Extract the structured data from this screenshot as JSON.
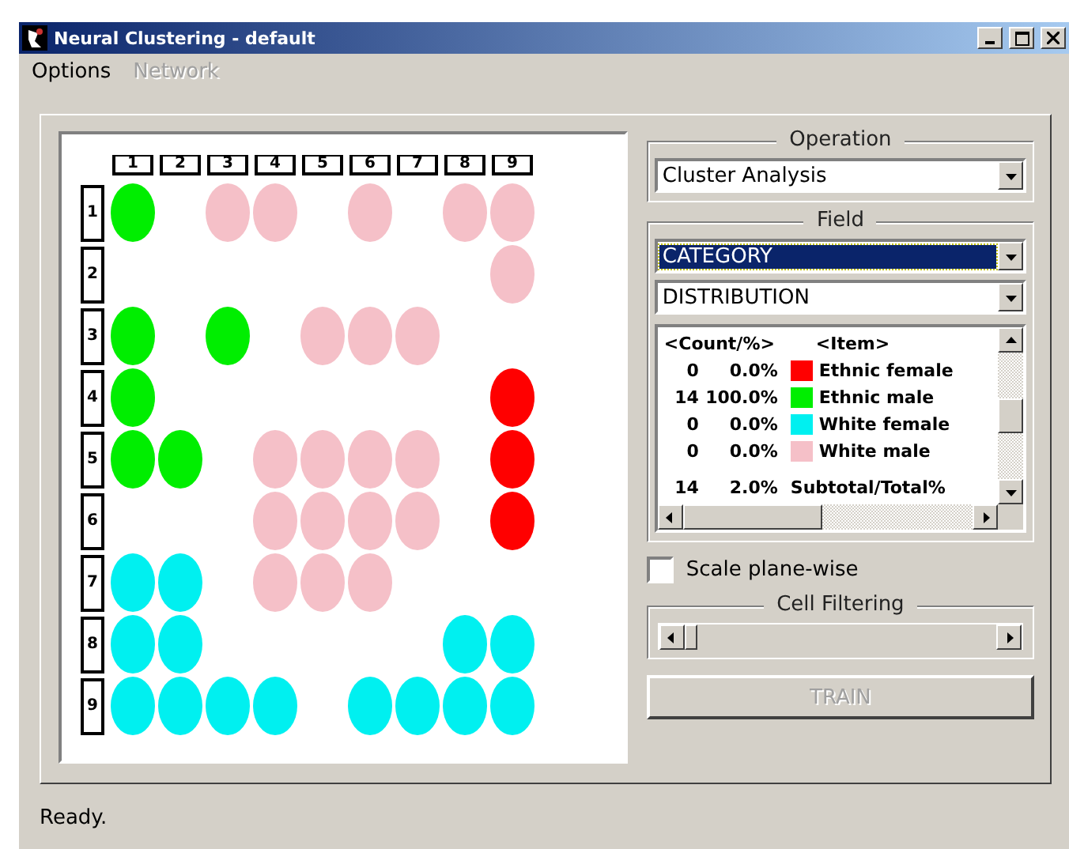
{
  "window": {
    "title": "Neural Clustering - default"
  },
  "menu": [
    {
      "label": "Options",
      "disabled": false
    },
    {
      "label": "Network",
      "disabled": true
    }
  ],
  "map": {
    "column_headers": [
      "1",
      "2",
      "3",
      "4",
      "5",
      "6",
      "7",
      "8",
      "9"
    ],
    "rows": [
      {
        "label": "1",
        "cells": [
          {
            "color": "#00ee00"
          },
          null,
          {
            "color": "#f5c0c8"
          },
          {
            "color": "#f5c0c8"
          },
          null,
          {
            "color": "#f5c0c8"
          },
          null,
          {
            "color": "#f5c0c8"
          },
          {
            "color": "#f5c0c8"
          }
        ]
      },
      {
        "label": "2",
        "cells": [
          null,
          null,
          null,
          null,
          null,
          null,
          null,
          null,
          {
            "color": "#f5c0c8"
          }
        ]
      },
      {
        "label": "3",
        "cells": [
          {
            "color": "#00ee00"
          },
          null,
          {
            "color": "#00ee00"
          },
          null,
          {
            "color": "#f5c0c8"
          },
          {
            "color": "#f5c0c8"
          },
          {
            "color": "#f5c0c8"
          },
          null,
          null
        ]
      },
      {
        "label": "4",
        "cells": [
          {
            "color": "#00ee00"
          },
          null,
          null,
          null,
          null,
          null,
          null,
          null,
          {
            "color": "#ff0000"
          }
        ]
      },
      {
        "label": "5",
        "cells": [
          {
            "color": "#00ee00"
          },
          {
            "color": "#00ee00"
          },
          null,
          {
            "color": "#f5c0c8"
          },
          {
            "color": "#f5c0c8"
          },
          {
            "color": "#f5c0c8"
          },
          {
            "color": "#f5c0c8"
          },
          null,
          {
            "color": "#ff0000"
          }
        ]
      },
      {
        "label": "6",
        "cells": [
          null,
          null,
          null,
          {
            "color": "#f5c0c8"
          },
          {
            "color": "#f5c0c8"
          },
          {
            "color": "#f5c0c8"
          },
          {
            "color": "#f5c0c8"
          },
          null,
          {
            "color": "#ff0000"
          }
        ]
      },
      {
        "label": "7",
        "cells": [
          {
            "color": "#00f0f0"
          },
          {
            "color": "#00f0f0"
          },
          null,
          {
            "color": "#f5c0c8"
          },
          {
            "color": "#f5c0c8"
          },
          {
            "color": "#f5c0c8"
          },
          null,
          null,
          null
        ]
      },
      {
        "label": "8",
        "cells": [
          {
            "color": "#00f0f0"
          },
          {
            "color": "#00f0f0"
          },
          null,
          null,
          null,
          null,
          null,
          {
            "color": "#00f0f0"
          },
          {
            "color": "#00f0f0"
          }
        ]
      },
      {
        "label": "9",
        "cells": [
          {
            "color": "#00f0f0"
          },
          {
            "color": "#00f0f0"
          },
          {
            "color": "#00f0f0"
          },
          {
            "color": "#00f0f0"
          },
          null,
          {
            "color": "#00f0f0"
          },
          {
            "color": "#00f0f0"
          },
          {
            "color": "#00f0f0"
          },
          {
            "color": "#00f0f0"
          }
        ]
      }
    ]
  },
  "operation": {
    "title": "Operation",
    "value": "Cluster Analysis"
  },
  "field": {
    "title": "Field",
    "selects": [
      {
        "value": "CATEGORY",
        "selected": true
      },
      {
        "value": "DISTRIBUTION",
        "selected": false
      }
    ]
  },
  "legend": {
    "header_count": "<Count/%>",
    "header_item": "<Item>",
    "items": [
      {
        "count": "0",
        "percent": "0.0%",
        "color": "#ff0000",
        "label": "Ethnic female"
      },
      {
        "count": "14",
        "percent": "100.0%",
        "color": "#00ee00",
        "label": "Ethnic male"
      },
      {
        "count": "0",
        "percent": "0.0%",
        "color": "#00f0f0",
        "label": "White female"
      },
      {
        "count": "0",
        "percent": "0.0%",
        "color": "#f5c0c8",
        "label": "White male"
      }
    ],
    "subtotal": {
      "count": "14",
      "percent": "2.0%",
      "label": "Subtotal/Total%"
    }
  },
  "scale_plane_wise": {
    "label": "Scale plane-wise",
    "checked": false
  },
  "cell_filtering": {
    "title": "Cell Filtering"
  },
  "train": {
    "label": "TRAIN",
    "disabled": true
  },
  "status_bar": "Ready."
}
